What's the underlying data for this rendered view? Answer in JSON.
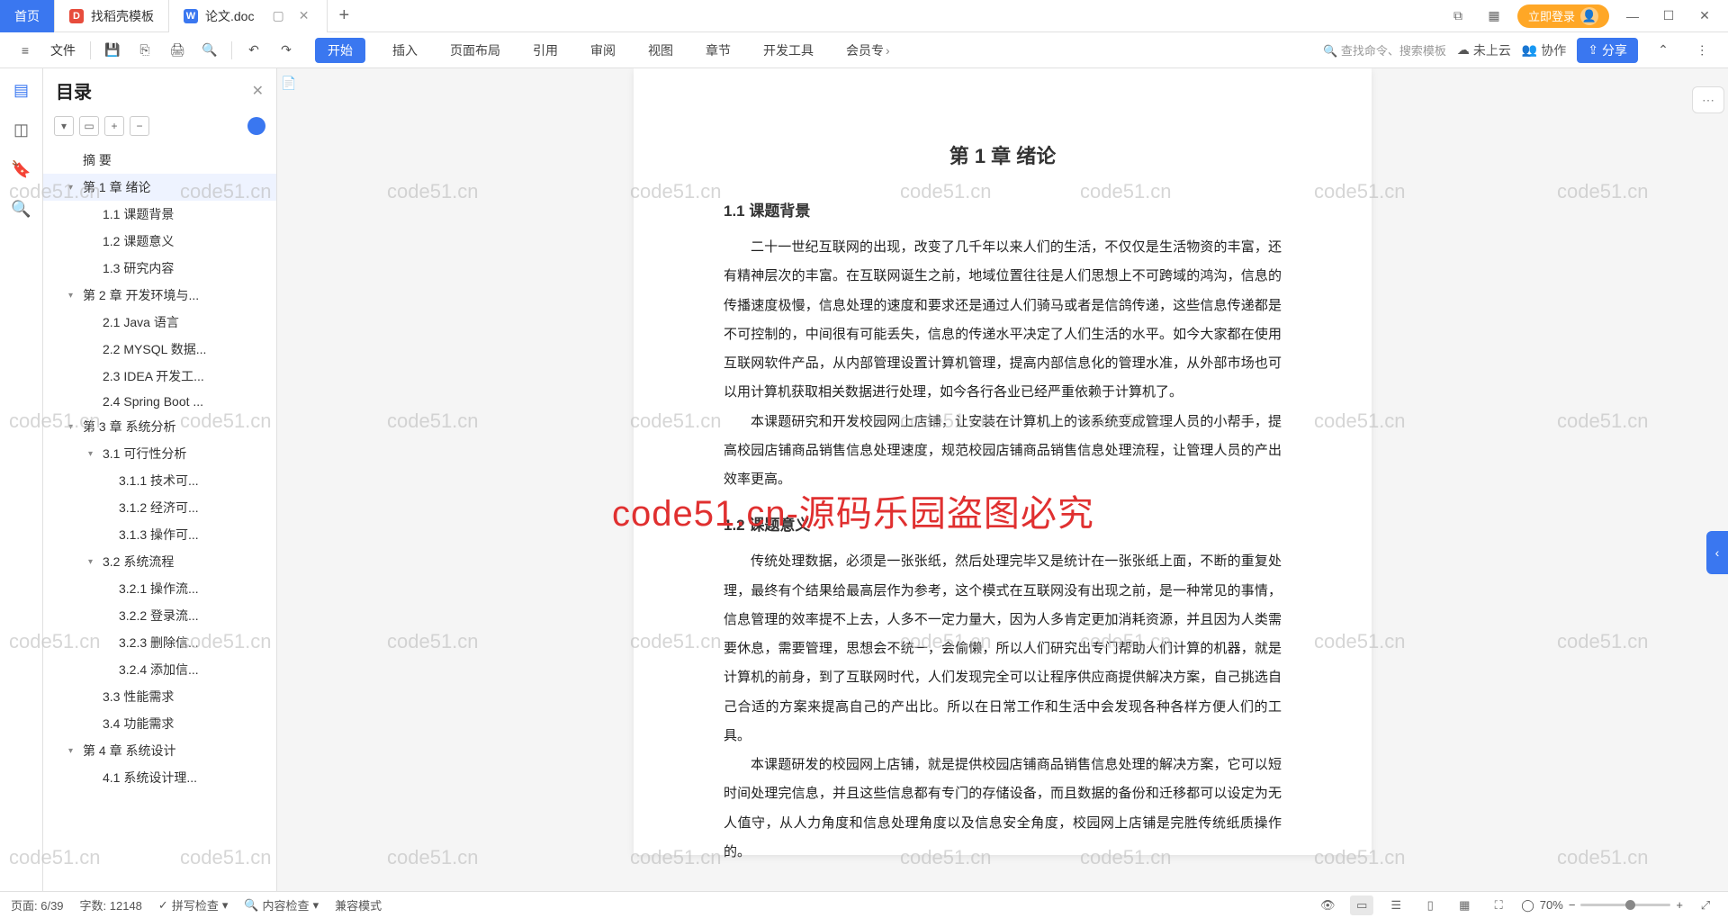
{
  "tabs": {
    "home": "首页",
    "t1": "找稻壳模板",
    "t2": "论文.doc"
  },
  "login_label": "立即登录",
  "file_label": "文件",
  "ribbon_tabs": [
    "开始",
    "插入",
    "页面布局",
    "引用",
    "审阅",
    "视图",
    "章节",
    "开发工具",
    "会员专"
  ],
  "search_hint": "查找命令、搜索模板",
  "cloud_label": "未上云",
  "collab_label": "协作",
  "share_label": "分享",
  "toc_title": "目录",
  "toc": [
    {
      "lvl": 1,
      "chev": "",
      "t": "摘  要"
    },
    {
      "lvl": 1,
      "chev": "▾",
      "t": "第 1 章  绪论",
      "active": true
    },
    {
      "lvl": 2,
      "chev": "",
      "t": "1.1  课题背景"
    },
    {
      "lvl": 2,
      "chev": "",
      "t": "1.2  课题意义"
    },
    {
      "lvl": 2,
      "chev": "",
      "t": "1.3  研究内容"
    },
    {
      "lvl": 1,
      "chev": "▾",
      "t": "第 2 章  开发环境与..."
    },
    {
      "lvl": 2,
      "chev": "",
      "t": "2.1 Java 语言"
    },
    {
      "lvl": 2,
      "chev": "",
      "t": "2.2 MYSQL 数据..."
    },
    {
      "lvl": 2,
      "chev": "",
      "t": "2.3 IDEA 开发工..."
    },
    {
      "lvl": 2,
      "chev": "",
      "t": "2.4 Spring Boot ..."
    },
    {
      "lvl": 1,
      "chev": "▾",
      "t": "第 3 章  系统分析"
    },
    {
      "lvl": 2,
      "chev": "▾",
      "t": "3.1  可行性分析"
    },
    {
      "lvl": 3,
      "chev": "",
      "t": "3.1.1  技术可..."
    },
    {
      "lvl": 3,
      "chev": "",
      "t": "3.1.2  经济可..."
    },
    {
      "lvl": 3,
      "chev": "",
      "t": "3.1.3  操作可..."
    },
    {
      "lvl": 2,
      "chev": "▾",
      "t": "3.2  系统流程"
    },
    {
      "lvl": 3,
      "chev": "",
      "t": "3.2.1  操作流..."
    },
    {
      "lvl": 3,
      "chev": "",
      "t": "3.2.2  登录流..."
    },
    {
      "lvl": 3,
      "chev": "",
      "t": "3.2.3  删除信..."
    },
    {
      "lvl": 3,
      "chev": "",
      "t": "3.2.4  添加信..."
    },
    {
      "lvl": 2,
      "chev": "",
      "t": "3.3  性能需求"
    },
    {
      "lvl": 2,
      "chev": "",
      "t": "3.4  功能需求"
    },
    {
      "lvl": 1,
      "chev": "▾",
      "t": "第 4 章  系统设计"
    },
    {
      "lvl": 2,
      "chev": "",
      "t": "4.1  系统设计理..."
    }
  ],
  "doc": {
    "chapter": "第 1 章  绪论",
    "s1_title": "1.1  课题背景",
    "s1_p1": "二十一世纪互联网的出现，改变了几千年以来人们的生活，不仅仅是生活物资的丰富，还有精神层次的丰富。在互联网诞生之前，地域位置往往是人们思想上不可跨域的鸿沟，信息的传播速度极慢，信息处理的速度和要求还是通过人们骑马或者是信鸽传递，这些信息传递都是不可控制的，中间很有可能丢失，信息的传递水平决定了人们生活的水平。如今大家都在使用互联网软件产品，从内部管理设置计算机管理，提高内部信息化的管理水准，从外部市场也可以用计算机获取相关数据进行处理，如今各行各业已经严重依赖于计算机了。",
    "s1_p2": "本课题研究和开发校园网上店铺，让安装在计算机上的该系统变成管理人员的小帮手，提高校园店铺商品销售信息处理速度，规范校园店铺商品销售信息处理流程，让管理人员的产出效率更高。",
    "s2_title": "1.2  课题意义",
    "s2_p1": "传统处理数据，必须是一张张纸，然后处理完毕又是统计在一张张纸上面，不断的重复处理，最终有个结果给最高层作为参考，这个模式在互联网没有出现之前，是一种常见的事情，信息管理的效率提不上去，人多不一定力量大，因为人多肯定更加消耗资源，并且因为人类需要休息，需要管理，思想会不统一，会偷懒，所以人们研究出专门帮助人们计算的机器，就是计算机的前身，到了互联网时代，人们发现完全可以让程序供应商提供解决方案，自己挑选自己合适的方案来提高自己的产出比。所以在日常工作和生活中会发现各种各样方便人们的工具。",
    "s2_p2": "本课题研发的校园网上店铺，就是提供校园店铺商品销售信息处理的解决方案，它可以短时间处理完信息，并且这些信息都有专门的存储设备，而且数据的备份和迁移都可以设定为无人值守，从人力角度和信息处理角度以及信息安全角度，校园网上店铺是完胜传统纸质操作的。"
  },
  "status": {
    "page": "页面: 6/39",
    "words": "字数: 12148",
    "spell": "拼写检查",
    "content": "内容检查",
    "compat": "兼容模式",
    "zoom": "70%"
  },
  "watermark_text": "code51.cn",
  "watermark_red": "code51.cn-源码乐园盗图必究"
}
